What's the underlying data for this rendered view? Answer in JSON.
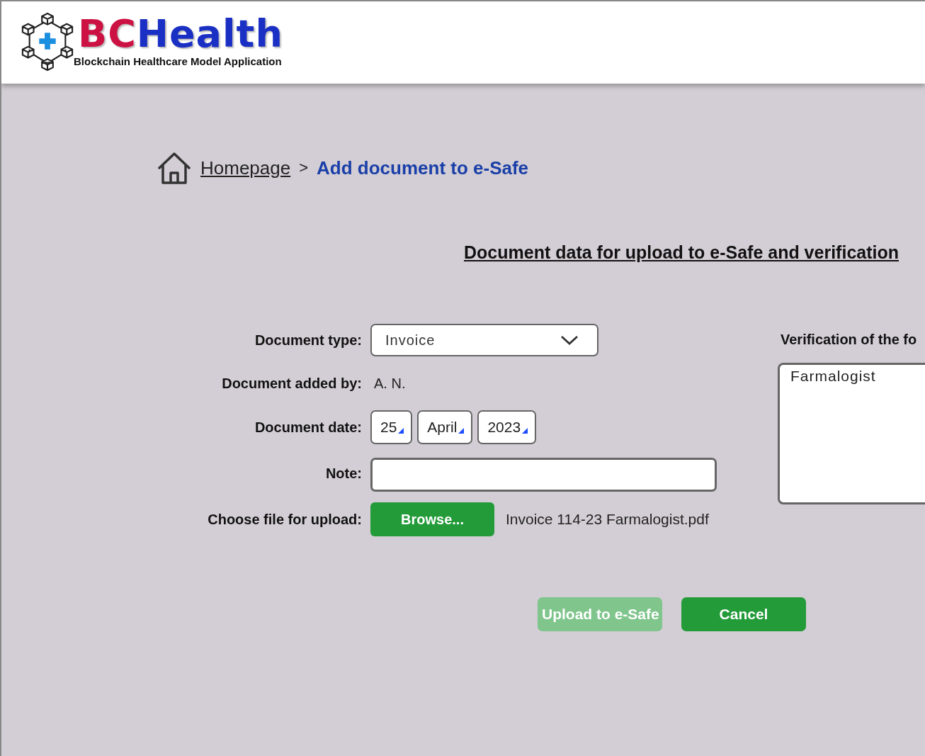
{
  "header": {
    "brand_first": "BC",
    "brand_second": "Health",
    "tagline": "Blockchain Healthcare Model Application"
  },
  "breadcrumb": [
    {
      "label": "Homepage",
      "kind": "link"
    },
    {
      "label": ">",
      "kind": "separator"
    },
    {
      "label": "Add document to e-Safe",
      "kind": "current"
    }
  ],
  "section_title": "Document data for upload to e-Safe and verification",
  "form": {
    "document_type": {
      "label": "Document type:",
      "value": "Invoice"
    },
    "added_by": {
      "label": "Document added by:",
      "value": "A. N."
    },
    "date": {
      "label": "Document date:",
      "parts": [
        "25",
        "April",
        "2023"
      ]
    },
    "note": {
      "label": "Note:"
    },
    "file": {
      "label": "Choose file for upload:",
      "button": "Browse...",
      "file_name": "Invoice 114-23 Farmalogist.pdf"
    }
  },
  "verification": {
    "title": "Verification of the fo",
    "items": [
      {
        "label": "Farmalogist",
        "selected": false
      }
    ]
  },
  "buttons": [
    {
      "label": "Upload to e-Safe",
      "disabled": true
    },
    {
      "label": "Cancel",
      "disabled": false
    }
  ]
}
